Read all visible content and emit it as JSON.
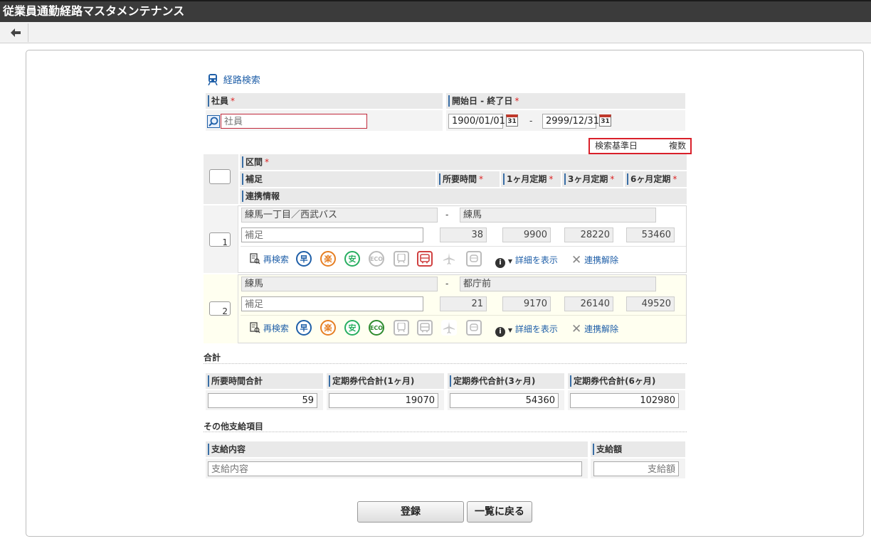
{
  "app": {
    "title": "従業員通勤経路マスタメンテナンス"
  },
  "route_search": {
    "label": "経路検索"
  },
  "fields": {
    "employee": {
      "label": "社員",
      "required": "*",
      "placeholder": "社員"
    },
    "period": {
      "label": "開始日 - 終了日",
      "required": "*",
      "start": "1900/01/01",
      "end": "2999/12/31",
      "separator": "-"
    },
    "calendar_day": "31"
  },
  "search_basis": {
    "label": "検索基準日",
    "value": "複数"
  },
  "segment_header": {
    "section": "区間",
    "note": "補足",
    "duration": "所要時間",
    "pass1": "1ヶ月定期",
    "pass3": "3ヶ月定期",
    "pass6": "6ヶ月定期",
    "link_info": "連携情報",
    "required": "*"
  },
  "rows": [
    {
      "no": "1",
      "from": "練馬一丁目／西武バス",
      "to": "練馬",
      "dash": "-",
      "note_placeholder": "補足",
      "duration": "38",
      "pass1": "9900",
      "pass3": "28220",
      "pass6": "53460",
      "research": "再検索",
      "detail": "詳細を表示",
      "unlink": "連携解除"
    },
    {
      "no": "2",
      "from": "練馬",
      "to": "都庁前",
      "dash": "-",
      "note_placeholder": "補足",
      "duration": "21",
      "pass1": "9170",
      "pass3": "26140",
      "pass6": "49520",
      "research": "再検索",
      "detail": "詳細を表示",
      "unlink": "連携解除"
    }
  ],
  "route_badges": {
    "fast": "早",
    "easy": "楽",
    "cheap": "安",
    "eco": "ECO"
  },
  "totals": {
    "label": "合計",
    "duration": {
      "label": "所要時間合計",
      "value": "59"
    },
    "pass1": {
      "label": "定期券代合計(1ヶ月)",
      "value": "19070"
    },
    "pass3": {
      "label": "定期券代合計(3ヶ月)",
      "value": "54360"
    },
    "pass6": {
      "label": "定期券代合計(6ヶ月)",
      "value": "102980"
    }
  },
  "other": {
    "label": "その他支給項目",
    "content": {
      "label": "支給内容",
      "placeholder": "支給内容"
    },
    "amount": {
      "label": "支給額",
      "placeholder": "支給額"
    }
  },
  "buttons": {
    "register": "登録",
    "back_to_list": "一覧に戻る"
  },
  "colors": {
    "accent": "#3a6ea5",
    "fast": "#1f5fa8",
    "easy": "#e67e22",
    "cheap": "#27ae60",
    "eco_active": "#2e8b2e",
    "bus_active": "#d04040",
    "highlight": "#d9202a",
    "row2_bg": "#fffff0"
  }
}
